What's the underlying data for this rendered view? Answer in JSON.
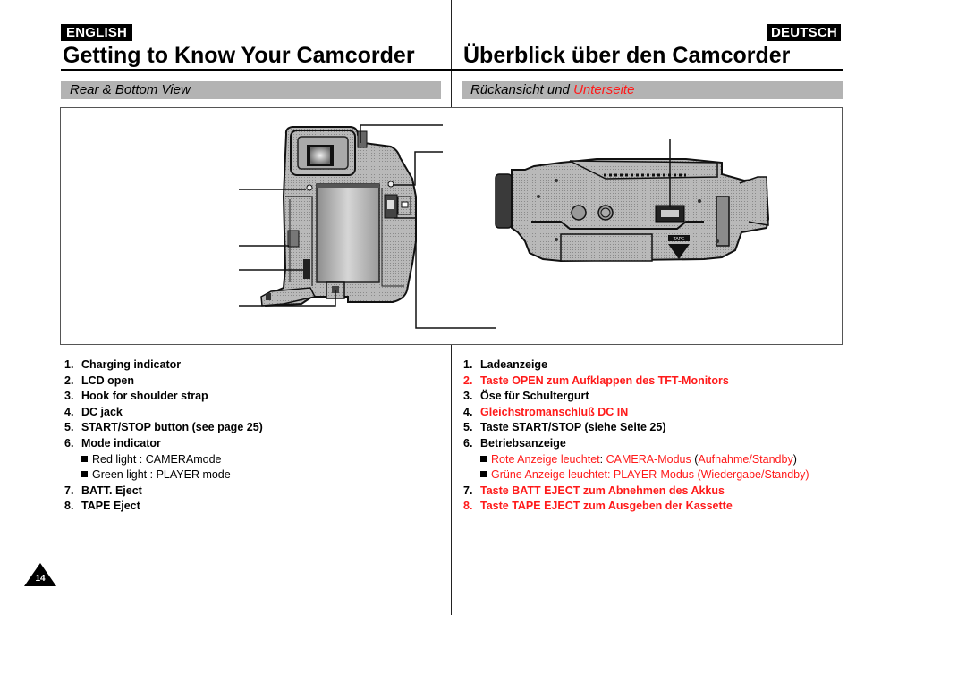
{
  "english": {
    "language_tag": "ENGLISH",
    "title": "Getting to Know Your Camcorder",
    "section": "Rear & Bottom View",
    "items": [
      {
        "num": "1.",
        "text": "Charging indicator"
      },
      {
        "num": "2.",
        "text": "LCD open"
      },
      {
        "num": "3.",
        "text": "Hook for shoulder strap"
      },
      {
        "num": "4.",
        "text": "DC jack"
      },
      {
        "num": "5.",
        "text": "START/STOP button (see page 25)"
      },
      {
        "num": "6.",
        "text": "Mode indicator"
      },
      {
        "num": "7.",
        "text": "BATT. Eject"
      },
      {
        "num": "8.",
        "text": "TAPE Eject"
      }
    ],
    "sub_items": [
      "Red light : CAMERAmode",
      "Green light : PLAYER mode"
    ]
  },
  "deutsch": {
    "language_tag": "DEUTSCH",
    "title": "Überblick über den Camcorder",
    "section_part1": "Rückansicht und ",
    "section_part2": "Unterseite",
    "items": [
      {
        "num": "1.",
        "text": "Ladeanzeige",
        "highlight": false
      },
      {
        "num": "2.",
        "text": "Taste OPEN zum Aufklappen des TFT-Monitors",
        "highlight": true
      },
      {
        "num": "3.",
        "text": "Öse für Schultergurt",
        "highlight": false
      },
      {
        "num": "4.",
        "text": "Gleichstromanschluß DC IN",
        "highlight": true
      },
      {
        "num": "5.",
        "text": "Taste START/STOP (siehe Seite 25)",
        "highlight": false
      },
      {
        "num": "6.",
        "text": "Betriebsanzeige",
        "highlight": false
      },
      {
        "num": "7.",
        "text": "Taste BATT EJECT zum Abnehmen des Akkus",
        "highlight": true
      },
      {
        "num": "8.",
        "text": "Taste TAPE EJECT zum Ausgeben der Kassette",
        "highlight": true
      }
    ],
    "sub_items": [
      {
        "a": "Rote Anzeige leuchtet",
        "b": ": ",
        "c": "CAMERA-Modus",
        "d": " (",
        "e": "Aufnahme/Standby",
        "f": ")"
      },
      {
        "a": "Grüne Anzeige leuchtet: PLAYER-Modus (Wiedergabe/Standby)"
      }
    ]
  },
  "figure": {
    "rear_view": "camcorder-rear-view",
    "bottom_view": "camcorder-bottom-view",
    "eject_label": "TAPE"
  },
  "page_number": "14",
  "colors": {
    "accent_red": "#ff1a1a",
    "section_gray": "#b3b3b3"
  }
}
